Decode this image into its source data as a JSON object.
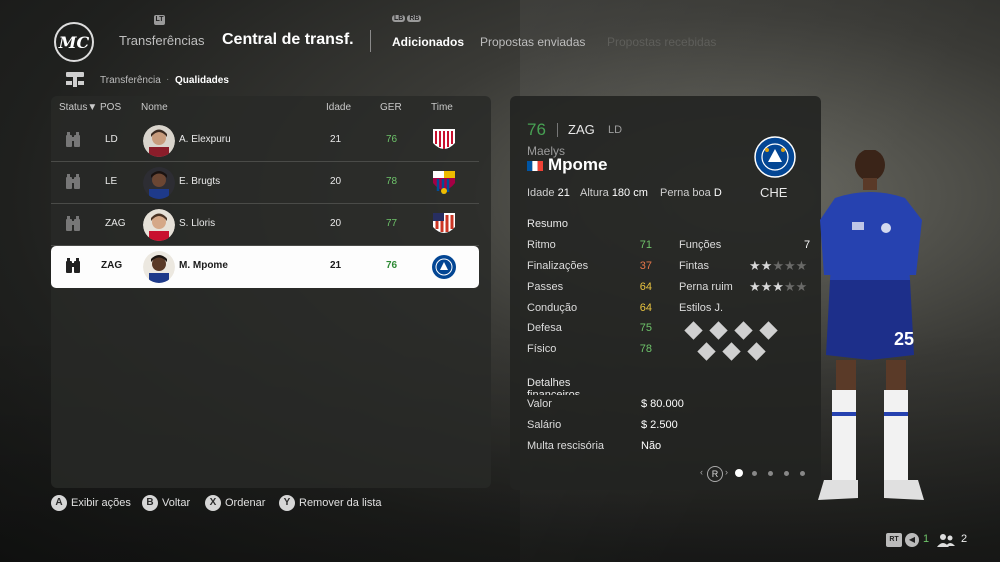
{
  "header": {
    "logo_text": "MC",
    "lt_hint": "LT",
    "lb_hint": "LB",
    "rb_hint": "RB",
    "nav_transfers": "Transferências",
    "nav_central": "Central de transf.",
    "tabs": [
      "Adicionados",
      "Propostas enviadas",
      "Propostas recebidas"
    ]
  },
  "breadcrumb": {
    "item1": "Transferência",
    "item2": "Qualidades"
  },
  "table": {
    "headers": {
      "status": "Status",
      "sort_arrow": "▼",
      "pos": "POS",
      "name": "Nome",
      "age": "Idade",
      "ovr": "GER",
      "club": "Time"
    },
    "rows": [
      {
        "pos": "LD",
        "name": "A. Elexpuru",
        "age": "21",
        "ovr": "76",
        "club": "athletic"
      },
      {
        "pos": "LE",
        "name": "E. Brugts",
        "age": "20",
        "ovr": "78",
        "club": "barcelona"
      },
      {
        "pos": "ZAG",
        "name": "S. Lloris",
        "age": "20",
        "ovr": "77",
        "club": "atletico"
      },
      {
        "pos": "ZAG",
        "name": "M. Mpome",
        "age": "21",
        "ovr": "76",
        "club": "chelsea"
      }
    ]
  },
  "player": {
    "ovr": "76",
    "position": "ZAG",
    "alt_position": "LD",
    "first_name": "Maelys",
    "last_name": "Mpome",
    "age_label": "Idade",
    "age": "21",
    "height_label": "Altura",
    "height": "180 cm",
    "foot_label": "Perna boa",
    "foot": "D",
    "club_code": "CHE",
    "summary_title": "Resumo",
    "stats": [
      {
        "label": "Ritmo",
        "value": "71",
        "color": "#6ec46a"
      },
      {
        "label": "Finalizações",
        "value": "37",
        "color": "#e6774a"
      },
      {
        "label": "Passes",
        "value": "64",
        "color": "#e9c440"
      },
      {
        "label": "Condução",
        "value": "64",
        "color": "#e9c440"
      },
      {
        "label": "Defesa",
        "value": "75",
        "color": "#6ec46a"
      },
      {
        "label": "Físico",
        "value": "78",
        "color": "#6ec46a"
      }
    ],
    "funcs_label": "Funções disponíveis",
    "funcs_value": "7",
    "skills_label": "Fintas",
    "skills_stars": 2,
    "weakfoot_label": "Perna ruim",
    "weakfoot_stars": 3,
    "playstyles_label": "Estilos J.",
    "financial_title": "Detalhes financeiros",
    "value_label": "Valor",
    "value": "$ 80.000",
    "wage_label": "Salário",
    "wage": "$ 2.500",
    "clause_label": "Multa rescisória",
    "clause": "Não",
    "page_hint": "R",
    "shirt_number": "25"
  },
  "footer": {
    "a": "A",
    "a_label": "Exibir ações",
    "b": "B",
    "b_label": "Voltar",
    "x": "X",
    "x_label": "Ordenar",
    "y": "Y",
    "y_label": "Remover da lista",
    "rt": "RT",
    "count1": "1",
    "count2": "2"
  },
  "colors": {
    "accent_green": "#47a153",
    "panel": "#282927"
  }
}
